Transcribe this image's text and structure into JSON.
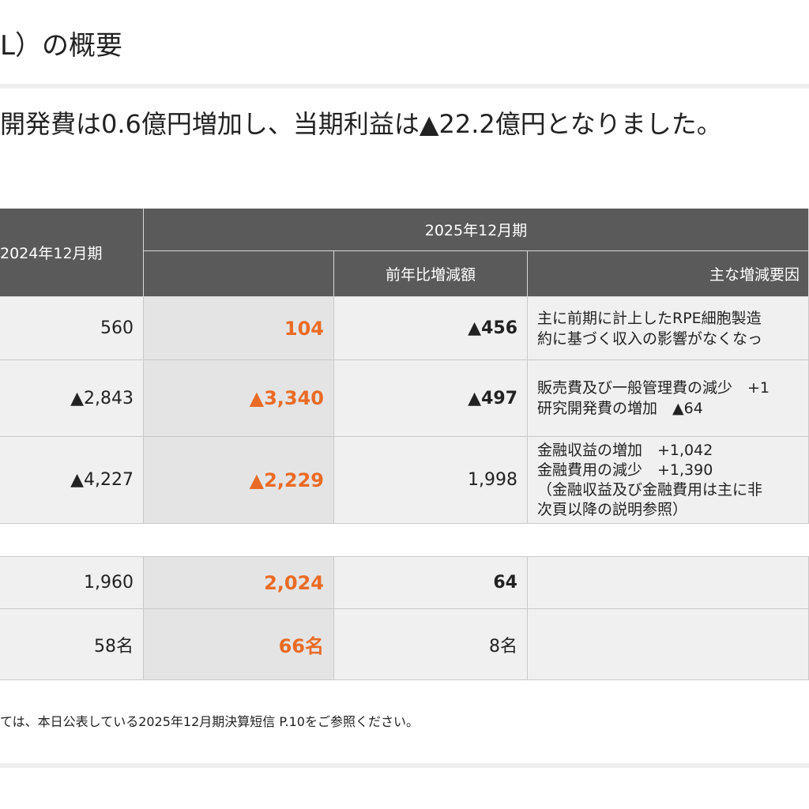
{
  "title": "L）の概要",
  "summary": "開発費は0.6億円増加し、当期利益は▲22.2億円となりました。",
  "table": {
    "col_prev_header": "2024年12月期",
    "col_cur_header": "2025年12月期",
    "col_diff_header": "前年比増減額",
    "col_reason_header": "主な増減要因",
    "rows": [
      {
        "prev": "560",
        "cur": "104",
        "diff": "▲456",
        "reasons": [
          "主に前期に計上したRPE細胞製造",
          "約に基づく収入の影響がなくなっ"
        ]
      },
      {
        "prev": "▲2,843",
        "cur": "▲3,340",
        "diff": "▲497",
        "reasons": [
          "販売費及び一般管理費の減少　+1",
          "研究開発費の増加　▲64"
        ]
      },
      {
        "prev": "▲4,227",
        "cur": "▲2,229",
        "diff": "1,998",
        "reasons": [
          "金融収益の増加　+1,042",
          "金融費用の減少　+1,390",
          "（金融収益及び金融費用は主に非",
          "次頁以降の説明参照）"
        ]
      },
      {
        "prev": "1,960",
        "cur": "2,024",
        "diff": "64",
        "reasons": []
      },
      {
        "prev": "58名",
        "cur": "66名",
        "diff": "8名",
        "reasons": []
      }
    ]
  },
  "footnote": "ては、本日公表している2025年12月期決算短信 P.10をご参照ください。",
  "colors": {
    "header_bg": "#5a5a5a",
    "highlight": "#ea6b25",
    "cell_bg": "#f0f0f0"
  }
}
